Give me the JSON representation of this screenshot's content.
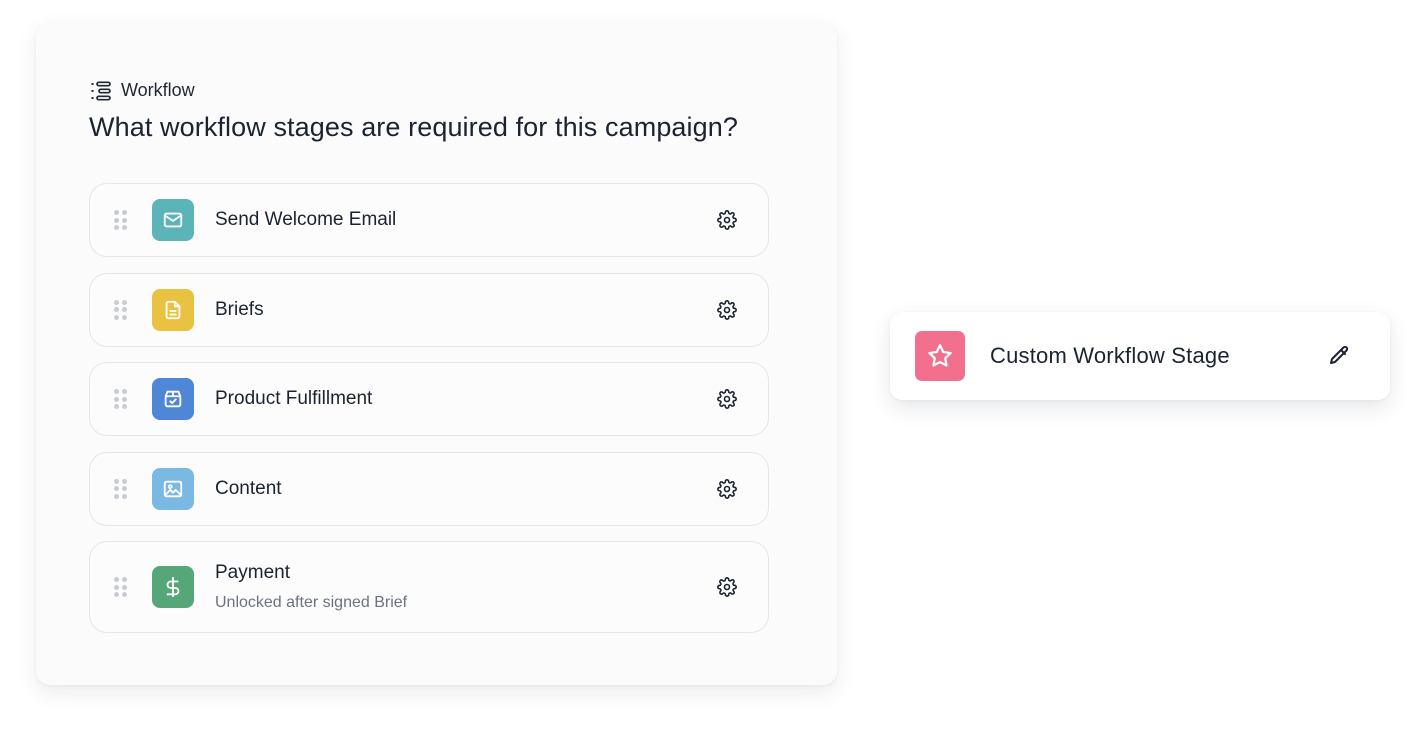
{
  "workflow": {
    "eyebrow_icon": "workflow-list-icon",
    "eyebrow_label": "Workflow",
    "question": "What workflow stages are required for this campaign?",
    "stages": [
      {
        "label": "Send Welcome Email",
        "icon": "mail-icon",
        "color": "#5ab4b8"
      },
      {
        "label": "Briefs",
        "icon": "document-icon",
        "color": "#e8c240"
      },
      {
        "label": "Product Fulfillment",
        "icon": "package-check-icon",
        "color": "#4f86d6"
      },
      {
        "label": "Content",
        "icon": "image-icon",
        "color": "#79b9e3"
      },
      {
        "label": "Payment",
        "sublabel": "Unlocked after signed Brief",
        "icon": "dollar-icon",
        "color": "#55a678"
      }
    ],
    "stage_action_icon": "gear-icon",
    "drag_handle_icon": "drag-handle-icon"
  },
  "custom_stage": {
    "label": "Custom Workflow Stage",
    "icon": "star-icon",
    "color": "#f36f8e",
    "action_icon": "pencil-icon"
  }
}
